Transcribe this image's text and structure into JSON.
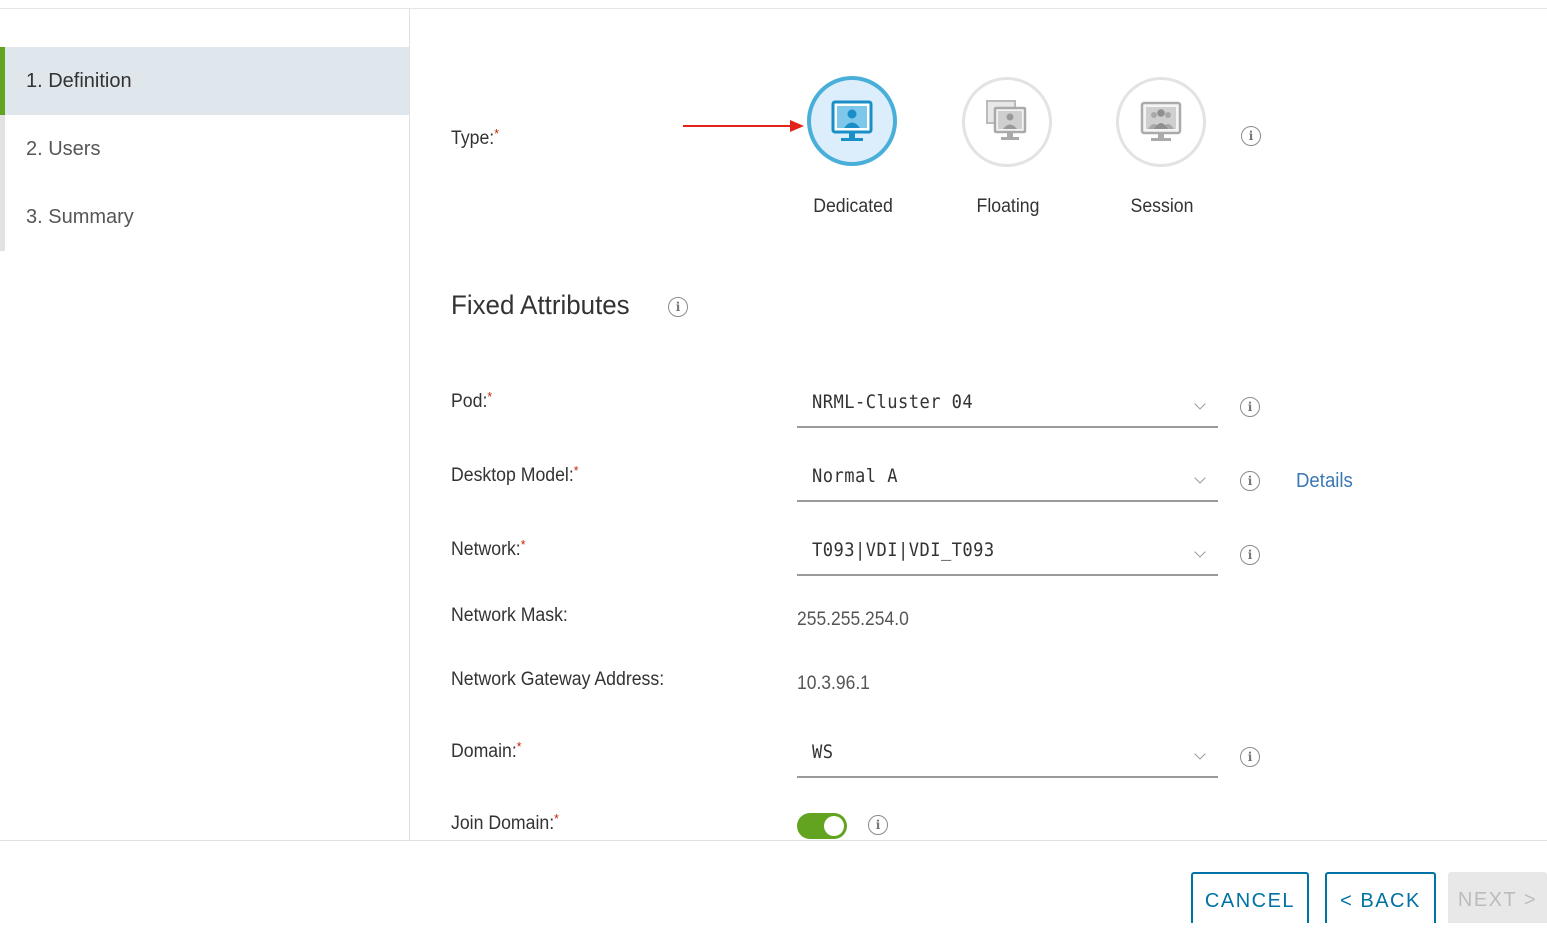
{
  "wizard": {
    "steps": [
      {
        "label": "1. Definition",
        "active": true
      },
      {
        "label": "2. Users",
        "active": false
      },
      {
        "label": "3. Summary",
        "active": false
      }
    ]
  },
  "type_field": {
    "label": "Type:",
    "required_mark": "*",
    "options": [
      {
        "label": "Dedicated",
        "selected": true
      },
      {
        "label": "Floating",
        "selected": false
      },
      {
        "label": "Session",
        "selected": false
      }
    ]
  },
  "section": {
    "title": "Fixed Attributes"
  },
  "fields": {
    "pod": {
      "label": "Pod:",
      "required_mark": "*",
      "value": "NRML-Cluster 04"
    },
    "desktop_model": {
      "label": "Desktop Model:",
      "required_mark": "*",
      "value": "Normal A",
      "details_link": "Details"
    },
    "network": {
      "label": "Network:",
      "required_mark": "*",
      "value": "T093|VDI|VDI_T093"
    },
    "network_mask": {
      "label": "Network Mask:",
      "value": "255.255.254.0"
    },
    "gateway": {
      "label": "Network Gateway Address:",
      "value": "10.3.96.1"
    },
    "domain": {
      "label": "Domain:",
      "required_mark": "*",
      "value": "WS"
    },
    "join_domain": {
      "label": "Join Domain:",
      "required_mark": "*",
      "enabled": true
    }
  },
  "info_glyph": "i",
  "footer": {
    "cancel": "CANCEL",
    "back": "< BACK",
    "next": "NEXT >"
  },
  "colors": {
    "accent_blue": "#0072a3",
    "selected_ring": "#49afd9",
    "active_step_bar": "#62a420",
    "required": "#c92100",
    "annotation_arrow": "#e2231a"
  }
}
